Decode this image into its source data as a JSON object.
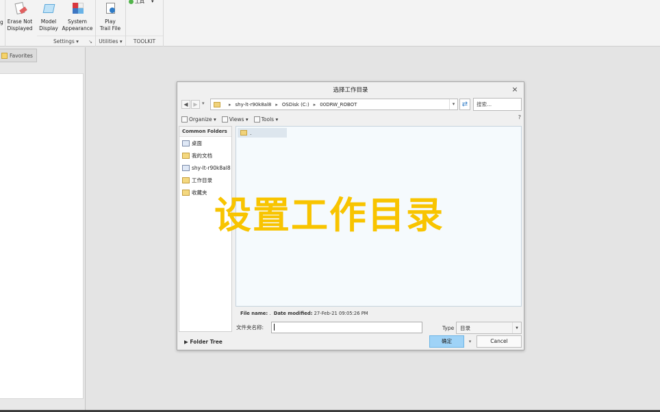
{
  "ribbon": {
    "left_cut_label": "g",
    "buttons": [
      {
        "label": "Erase Not\nDisplayed",
        "icon": "eraser-icon"
      },
      {
        "label": "Model\nDisplay",
        "icon": "cube-icon"
      },
      {
        "label": "System\nAppearance",
        "icon": "palette-icon"
      },
      {
        "label": "Play\nTrail File",
        "icon": "play-trail-icon"
      }
    ],
    "toolkit_item": "工具",
    "groups": {
      "settings": "Settings ▾",
      "utilities": "Utilities ▾",
      "toolkit": "TOOLKIT"
    }
  },
  "left_panel": {
    "tab_label": "Favorites"
  },
  "dialog": {
    "title": "选择工作目录",
    "close": "×",
    "address": {
      "crumbs": [
        "shy-lt-r90k8al8",
        "OSDisk (C:)",
        "00DRW_ROBOT"
      ],
      "separator": "▸"
    },
    "search_placeholder": "搜索...",
    "toolbar": {
      "organize": "Organize ▾",
      "views": "Views ▾",
      "tools": "Tools ▾",
      "right_icon": "?"
    },
    "common_folders": {
      "header": "Common Folders",
      "items": [
        "桌面",
        "我的文档",
        "shy-lt-r90k8al8",
        "工作目录",
        "收藏夹"
      ]
    },
    "files": [
      {
        "name": "."
      }
    ],
    "file_info": {
      "name_label": "File name:",
      "name_value": ".",
      "date_label": "Date modified:",
      "date_value": "27-Feb-21 09:05:26 PM"
    },
    "folder_name_label": "文件夹名称:",
    "folder_name_value": "",
    "type_label": "Type",
    "type_value": "目录",
    "folder_tree": "Folder Tree",
    "ok": "确定",
    "cancel": "Cancel"
  },
  "overlay_text": "设置工作目录",
  "colors": {
    "overlay": "#f8c400",
    "ok_button": "#9fd3f7",
    "file_list_bg": "#f5fafd"
  }
}
